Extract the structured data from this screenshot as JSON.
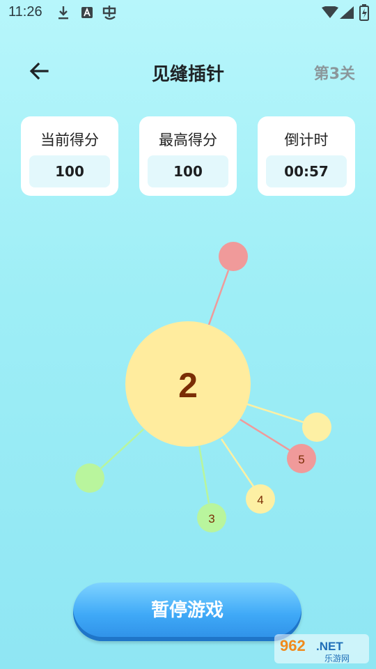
{
  "status_bar": {
    "time": "11:26"
  },
  "header": {
    "title": "见缝插针",
    "level": "第3关"
  },
  "stats": [
    {
      "label": "当前得分",
      "value": "100"
    },
    {
      "label": "最高得分",
      "value": "100"
    },
    {
      "label": "倒计时",
      "value": "00:57"
    }
  ],
  "game": {
    "hub_count": "2",
    "pins": [
      {
        "label": "",
        "color": "#f09a9a"
      },
      {
        "label": "",
        "color": "#fdf0a4"
      },
      {
        "label": "5",
        "color": "#f09a9a"
      },
      {
        "label": "4",
        "color": "#fdf0a4"
      },
      {
        "label": "3",
        "color": "#b9f59d"
      },
      {
        "label": "",
        "color": "#b9f59d"
      }
    ]
  },
  "pause_button": {
    "label": "暂停游戏"
  },
  "watermark": {
    "text": "962.NET 乐游网"
  },
  "colors": {
    "hub": "#ffec9e",
    "hub_text": "#7a2d05",
    "button": "#3fa9f7"
  }
}
